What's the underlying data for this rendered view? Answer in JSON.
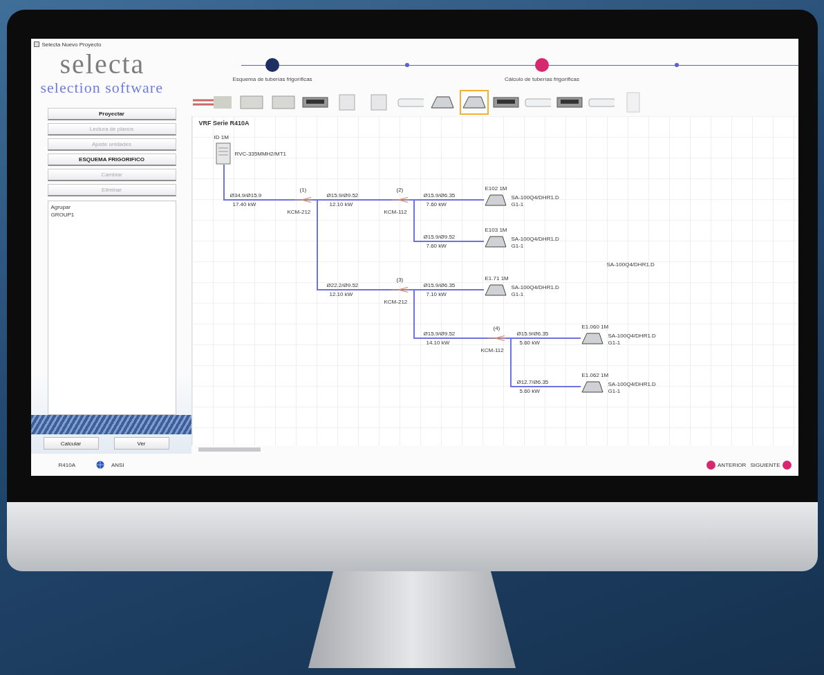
{
  "window": {
    "title": "Selecta Nuevo Proyecto"
  },
  "logo": {
    "name": "selecta",
    "tagline": "selection software"
  },
  "steps": [
    {
      "label": "Esquema de tuberías frigoríficas",
      "completed": true,
      "selected": false
    },
    {
      "completed": false,
      "selected": false
    },
    {
      "label": "Cálculo de tuberías frigoríficas",
      "completed": false,
      "selected": true
    },
    {
      "completed": false,
      "selected": false
    }
  ],
  "toolbar": [
    {
      "kind": "pipe",
      "selected": false
    },
    {
      "kind": "box",
      "selected": false
    },
    {
      "kind": "box",
      "selected": false
    },
    {
      "kind": "duct",
      "selected": false
    },
    {
      "kind": "panel",
      "selected": false
    },
    {
      "kind": "panel",
      "selected": false
    },
    {
      "kind": "wall",
      "selected": false
    },
    {
      "kind": "cassette",
      "selected": false
    },
    {
      "kind": "cassette",
      "selected": true
    },
    {
      "kind": "duct",
      "selected": false
    },
    {
      "kind": "wall",
      "selected": false
    },
    {
      "kind": "duct",
      "selected": false
    },
    {
      "kind": "wall",
      "selected": false
    },
    {
      "kind": "console",
      "selected": false
    }
  ],
  "sidebar": {
    "buttons": [
      {
        "label": "Proyectar",
        "disabled": false
      },
      {
        "label": "Lectura de planos",
        "disabled": true
      },
      {
        "label": "Ajuste unidades",
        "disabled": true
      },
      {
        "label": "ESQUEMA FRIGORIFICO",
        "disabled": false
      },
      {
        "label": "Cambiar",
        "disabled": true
      },
      {
        "label": "Eliminar",
        "disabled": true
      }
    ],
    "list": [
      "Agrupar",
      "GROUP1"
    ],
    "actions": [
      "Calcular",
      "Ver"
    ]
  },
  "diagram": {
    "title": "VRF Serie R410A",
    "outdoor": {
      "label": "ID 1M",
      "model": "RVC-335MMH2/MT1"
    },
    "joints": [
      {
        "label": "(1)",
        "kit": "KCM-212"
      },
      {
        "label": "(2)",
        "kit": "KCM-112"
      },
      {
        "label": "(3)",
        "kit": "KCM-212"
      },
      {
        "label": "(4)",
        "kit": "KCM-112"
      }
    ],
    "segments": [
      {
        "gas": "Ø34.9/Ø15.9",
        "length": "17.40 kW"
      },
      {
        "gas": "Ø15.9/Ø9.52",
        "length": "12.10 kW"
      },
      {
        "gas": "Ø15.9/Ø6.35",
        "length": "7.60 kW"
      },
      {
        "gas": "Ø15.9/Ø9.52",
        "length": "7.60 kW"
      },
      {
        "gas": "Ø22.2/Ø9.52",
        "length": "12.10 kW"
      },
      {
        "gas": "Ø15.9/Ø6.35",
        "length": "7.10 kW"
      },
      {
        "gas": "Ø15.9/Ø9.52",
        "length": "14.10 kW"
      },
      {
        "gas": "Ø15.9/Ø6.35",
        "length": "5.60 kW"
      },
      {
        "gas": "Ø12.7/Ø6.35",
        "length": "5.60 kW"
      }
    ],
    "indoor": [
      {
        "code": "E102 1M",
        "model": "SA-100Q4/DHR1.D",
        "group": "G1-1"
      },
      {
        "code": "E103 1M",
        "model": "SA-100Q4/DHR1.D",
        "group": "G1-1"
      },
      {
        "code": "E1.71 1M",
        "model": "SA-100Q4/DHR1.D",
        "group": "G1-1"
      },
      {
        "code": "E1.060 1M",
        "model": "SA-100Q4/DHR1.D",
        "group": "G1-1"
      },
      {
        "code": "E1.062 1M",
        "model": "SA-100Q4/DHR1.D",
        "group": "G1-1"
      }
    ],
    "notes": [
      "SA-100Q4/DHR1.D"
    ]
  },
  "status_bar": {
    "refrigerant": "R410A",
    "language": "ANSI",
    "back": "ANTERIOR",
    "next": "SIGUIENTE"
  }
}
